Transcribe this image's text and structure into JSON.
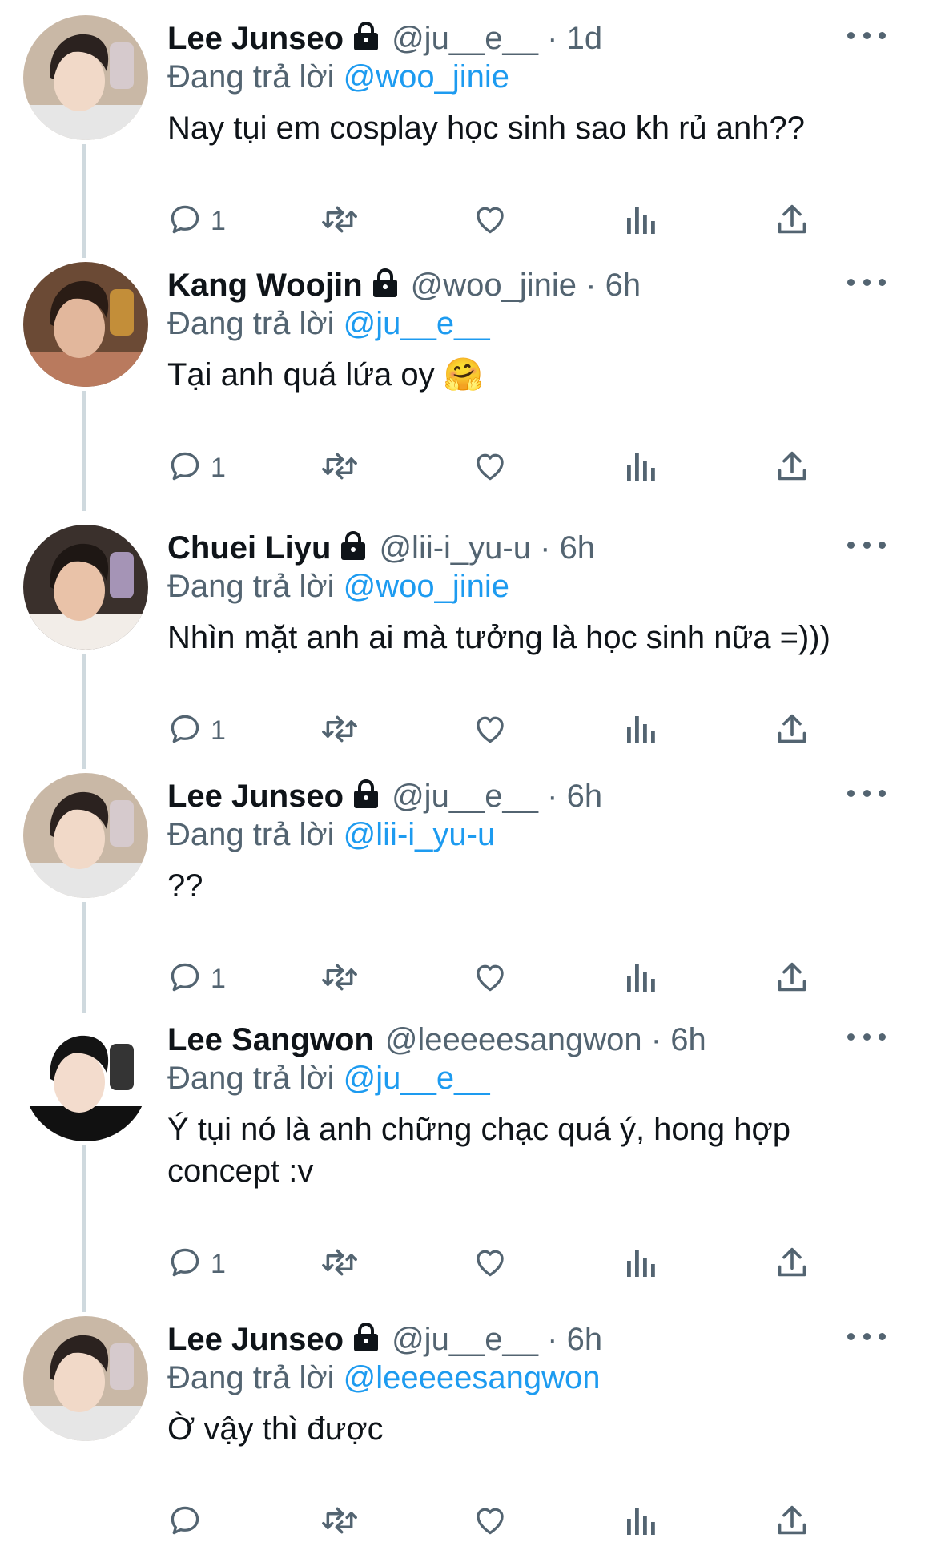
{
  "replying_label": "Đang trả lời",
  "tweets": [
    {
      "name": "Lee Junseo",
      "locked": true,
      "handle": "@ju__e__",
      "sep": "·",
      "time": "1d",
      "reply_to": "@woo_jinie",
      "text": "Nay tụi em cosplay học sinh sao kh rủ anh??",
      "reply_count": "1",
      "avatar": {
        "bg": "#c9b8a6",
        "skin": "#f1d9c8",
        "hair": "#2b221f",
        "cloth": "#e6e6e6",
        "prop": "#d8cdd4"
      }
    },
    {
      "name": "Kang Woojin",
      "locked": true,
      "handle": "@woo_jinie",
      "sep": "·",
      "time": "6h",
      "reply_to": "@ju__e__",
      "text": "Tại anh quá lứa oy 🤗",
      "reply_count": "1",
      "avatar": {
        "bg": "#6b4a35",
        "skin": "#e2b79c",
        "hair": "#2a1c15",
        "cloth": "#b97a5e",
        "prop": "#d29a3a"
      }
    },
    {
      "name": "Chuei Liyu",
      "locked": true,
      "handle": "@lii-i_yu-u",
      "sep": "·",
      "time": "6h",
      "reply_to": "@woo_jinie",
      "text": "Nhìn mặt anh ai mà tưởng là học sinh nữa =)))",
      "reply_count": "1",
      "avatar": {
        "bg": "#3a302c",
        "skin": "#e9c2a8",
        "hair": "#1e1714",
        "cloth": "#f2ede8",
        "prop": "#b9a6cf"
      }
    },
    {
      "name": "Lee Junseo",
      "locked": true,
      "handle": "@ju__e__",
      "sep": "·",
      "time": "6h",
      "reply_to": "@lii-i_yu-u",
      "text": "??",
      "reply_count": "1",
      "avatar": {
        "bg": "#c9b8a6",
        "skin": "#f1d9c8",
        "hair": "#2b221f",
        "cloth": "#e6e6e6",
        "prop": "#d8cdd4"
      }
    },
    {
      "name": "Lee Sangwon",
      "locked": false,
      "handle": "@leeeeesangwon",
      "sep": "·",
      "time": "6h",
      "reply_to": "@ju__e__",
      "text": "Ý tụi nó là anh chững chạc quá ý, hong hợp concept :v",
      "reply_count": "1",
      "avatar": {
        "bg": "#ffffff",
        "skin": "#f3dccd",
        "hair": "#141414",
        "cloth": "#111111",
        "prop": "#111111"
      }
    },
    {
      "name": "Lee Junseo",
      "locked": true,
      "handle": "@ju__e__",
      "sep": "·",
      "time": "6h",
      "reply_to": "@leeeeesangwon",
      "text": "Ờ vậy thì được",
      "reply_count": "",
      "avatar": {
        "bg": "#c9b8a6",
        "skin": "#f1d9c8",
        "hair": "#2b221f",
        "cloth": "#e6e6e6",
        "prop": "#d8cdd4"
      }
    }
  ],
  "colors": {
    "text": "#0f1419",
    "secondary": "#536471",
    "link": "#1d9bf0",
    "thread_line": "#cfd9de"
  }
}
